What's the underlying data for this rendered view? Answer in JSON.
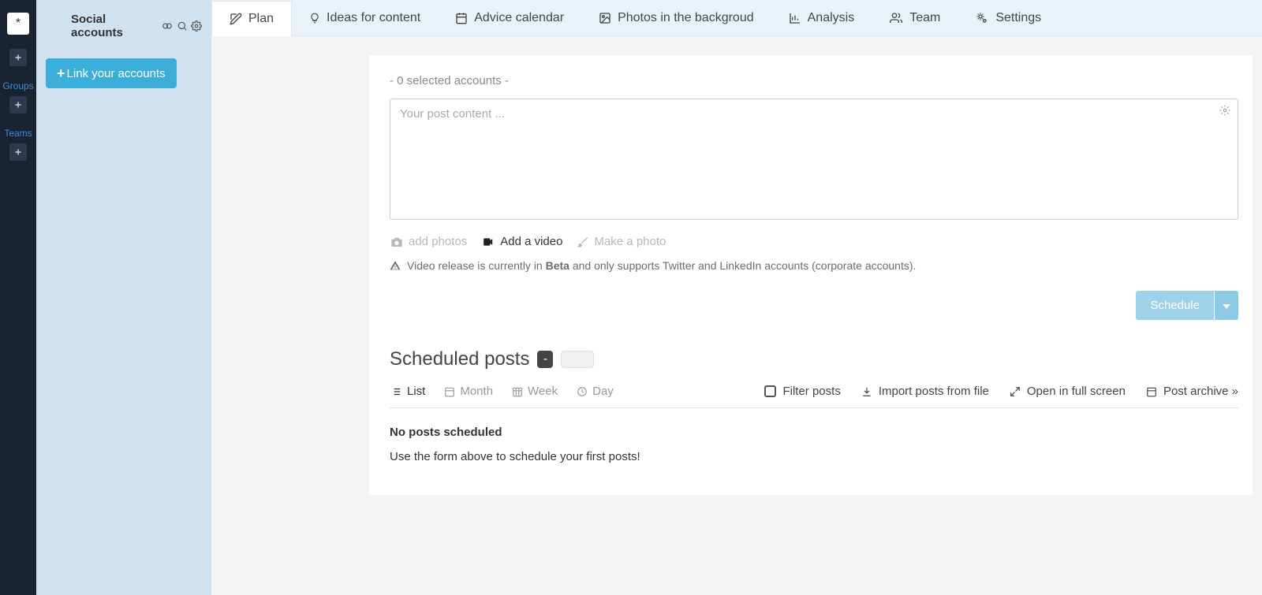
{
  "rail": {
    "avatar_symbol": "*",
    "groups_label": "Groups",
    "teams_label": "Teams"
  },
  "sidebar": {
    "title": "Social accounts",
    "link_button": "Link your accounts"
  },
  "nav": {
    "plan": "Plan",
    "ideas": "Ideas for content",
    "advice": "Advice calendar",
    "photos": "Photos in the backgroud",
    "analysis": "Analysis",
    "team": "Team",
    "settings": "Settings"
  },
  "composer": {
    "selected_accounts": "- 0 selected accounts -",
    "placeholder": "Your post content ...",
    "add_photos": "add photos",
    "add_video": "Add a video",
    "make_photo": "Make a photo",
    "beta_notice_pre": "Video release is currently in ",
    "beta_word": "Beta",
    "beta_notice_post": " and only supports Twitter and LinkedIn accounts (corporate accounts).",
    "schedule": "Schedule"
  },
  "scheduled": {
    "title": "Scheduled posts",
    "badge": "-",
    "views": {
      "list": "List",
      "month": "Month",
      "week": "Week",
      "day": "Day"
    },
    "actions": {
      "filter": "Filter posts",
      "import": "Import posts from file",
      "fullscreen": "Open in full screen",
      "archive": "Post archive »"
    },
    "empty_title": "No posts scheduled",
    "empty_sub": "Use the form above to schedule your first posts!"
  }
}
